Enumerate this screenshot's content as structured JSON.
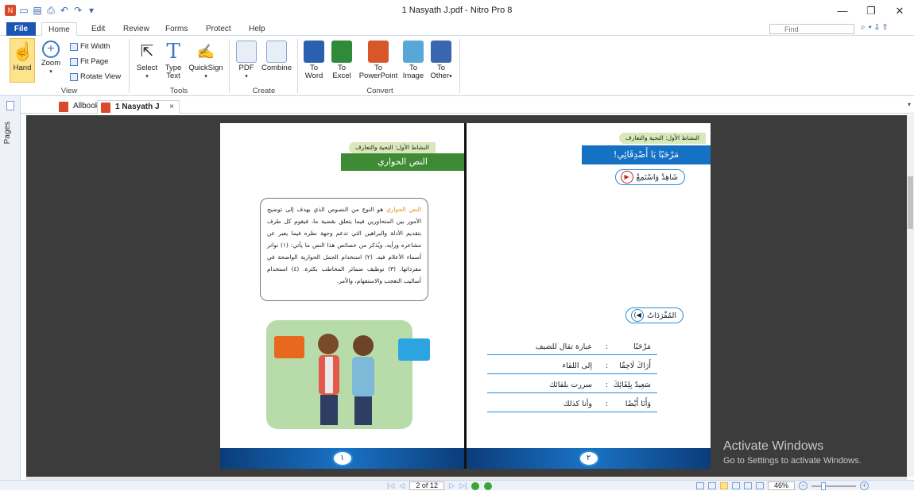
{
  "window": {
    "title": "1 Nasyath J.pdf - Nitro Pro 8"
  },
  "ribbon_tabs": [
    "File",
    "Home",
    "Edit",
    "Review",
    "Forms",
    "Protect",
    "Help"
  ],
  "find": {
    "placeholder": "Find"
  },
  "ribbon": {
    "view": {
      "hand": "Hand",
      "zoom": "Zoom",
      "fit_width": "Fit Width",
      "fit_page": "Fit Page",
      "rotate_view": "Rotate View",
      "label": "View"
    },
    "tools": {
      "select": "Select",
      "type_text_1": "Type",
      "type_text_2": "Text",
      "quicksign": "QuickSign",
      "label": "Tools"
    },
    "create": {
      "pdf": "PDF",
      "combine": "Combine",
      "label": "Create"
    },
    "convert": {
      "to_word_1": "To",
      "to_word_2": "Word",
      "to_excel_1": "To",
      "to_excel_2": "Excel",
      "to_ppt_1": "To",
      "to_ppt_2": "PowerPoint",
      "to_image_1": "To",
      "to_image_2": "Image",
      "to_other_1": "To",
      "to_other_2": "Other",
      "label": "Convert"
    }
  },
  "sidebar": {
    "pages_label": "Pages"
  },
  "doc_tabs": [
    "Allbook",
    "1 Nasyath J"
  ],
  "left_page": {
    "chip": "النشاط الأول: التحية والتعارف",
    "banner": "النص الحواري",
    "text_highlight": "النص الحواري",
    "text_body": " هو النوع من النصوص الذي يهدف إلى توضيح الأمور بين المتحاورين فيما يتعلق بقضية ما، فيقوم كل طرف بتقديم الأدلة والبراهين التي تدعم وجهة نظره فيما يعبر عن مشاعره ورأيه، ويُذكر من خصائص هذا النص ما يأتي: (١) تواتر أسماء الأعلام فيه. (٢) استخدام الجمل الحوارية الواضحة في مفرداتها. (٣) توظيف ضمائر المخاطب بكثرة. (٤) استخدام أساليب التعجب والاستفهام، والأمر.",
    "page_number": "١"
  },
  "right_page": {
    "chip": "النشاط الأول: التحية والتعارف",
    "banner": "مَرْحَبًا يَا أَصْدِقَائِي!",
    "watch_listen": "شَاهِدْ وَاسْتَمِعْ",
    "vocab_title": "المُفْرَدَاتُ",
    "vocab": [
      {
        "word": "مَرْحَبًا",
        "sep": ":",
        "meaning": "عبارة تقال للضيف"
      },
      {
        "word": "أَرَاكَ لَاحِقًا",
        "sep": ":",
        "meaning": "إلى اللقاء"
      },
      {
        "word": "سَعِيدٌ بِلِقَائِكَ",
        "sep": ":",
        "meaning": "سررت بلقائك"
      },
      {
        "word": "وَأَنَا أَيْضًا",
        "sep": ":",
        "meaning": "وأنا كذلك"
      }
    ],
    "page_number": "٢"
  },
  "watermark": {
    "line1": "Activate Windows",
    "line2": "Go to Settings to activate Windows."
  },
  "status": {
    "page": "2 of 12",
    "zoom": "46%"
  },
  "colors": {
    "file_tab": "#1c55b4",
    "green_banner": "#3f8a35",
    "blue_banner": "#1571c4",
    "viewer_bg": "#3c3c3c",
    "highlight": "#e38a16"
  }
}
